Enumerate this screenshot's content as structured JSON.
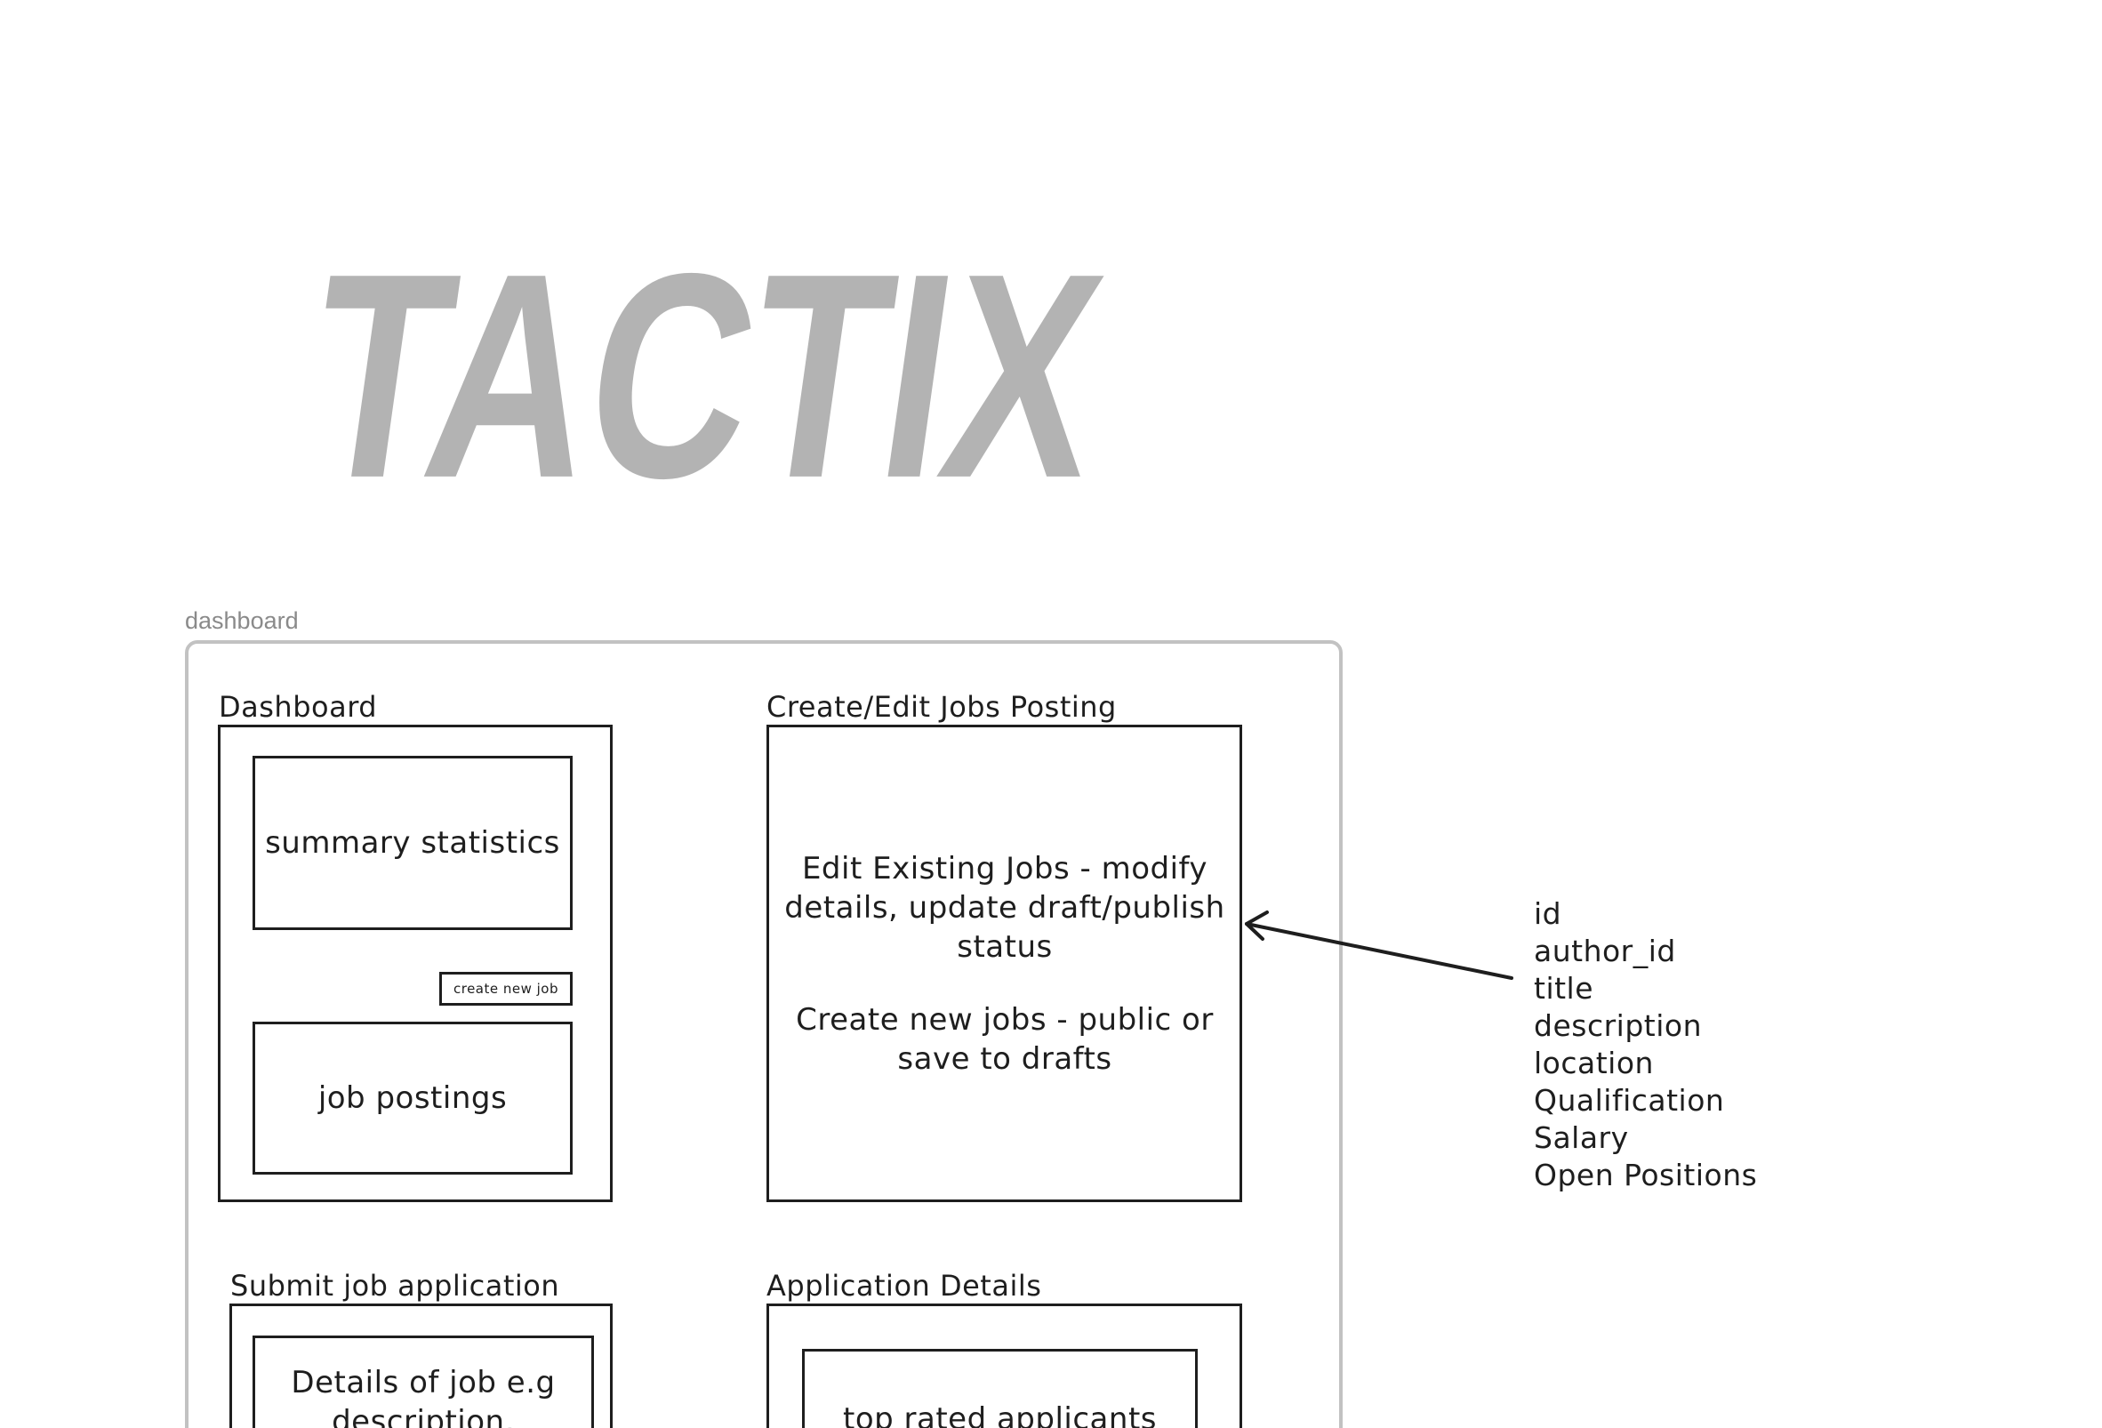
{
  "logo": {
    "text": "TACTIX",
    "color": "#b3b3b3"
  },
  "frame": {
    "label": "dashboard"
  },
  "dashboard_card": {
    "title": "Dashboard",
    "summary_label": "summary statistics",
    "create_button_label": "create new job",
    "postings_label": "job postings"
  },
  "jobs_card": {
    "title": "Create/Edit Jobs Posting",
    "edit_text": "Edit Existing Jobs - modify details, update draft/publish status",
    "create_text": "Create new jobs - public or save to drafts"
  },
  "fields": {
    "items": [
      "id",
      "author_id",
      "title",
      "description",
      "location",
      "Qualification",
      "Salary",
      "Open Positions"
    ]
  },
  "submit_card": {
    "title": "Submit job application",
    "details_text": "Details of job e.g description,"
  },
  "application_card": {
    "title": "Application Details",
    "applicants_label": "top rated applicants"
  },
  "colors": {
    "stroke": "#1e1e1e",
    "frame_border": "#c2c2c2",
    "frame_label": "#8a8a8a"
  }
}
